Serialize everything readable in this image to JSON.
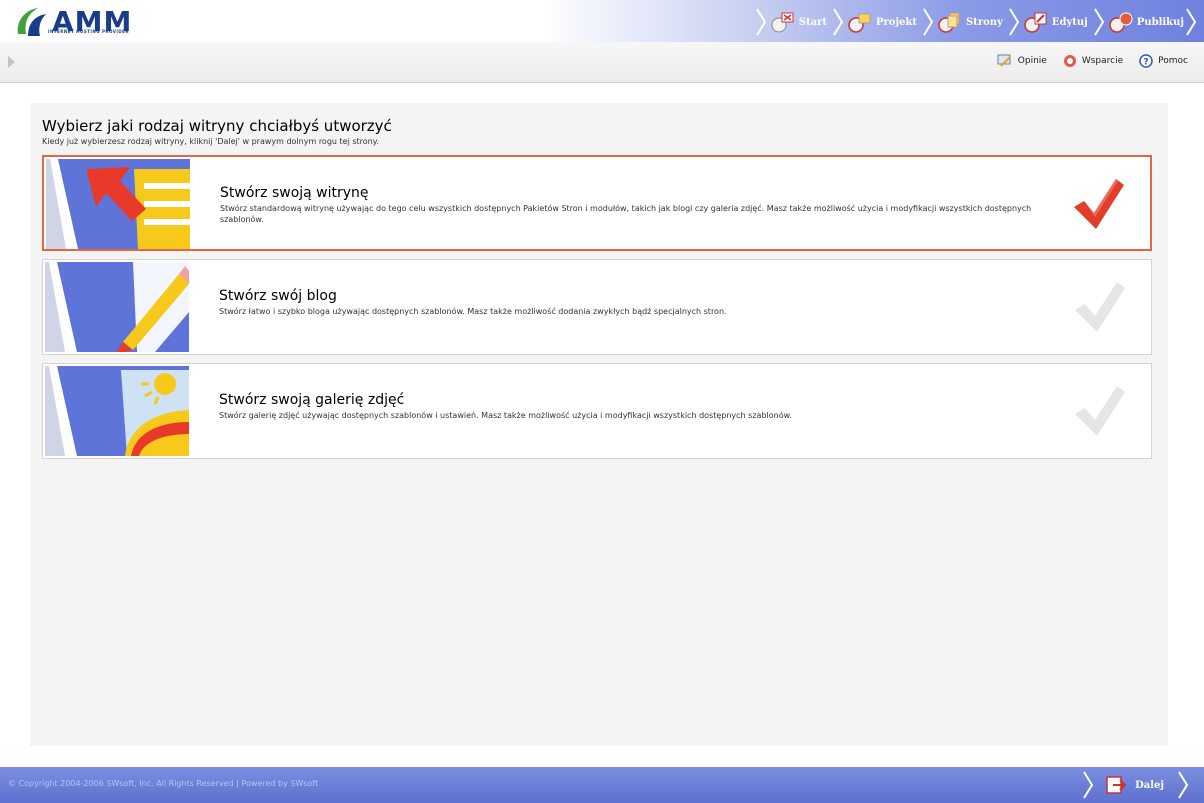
{
  "header": {
    "logo_text": "AMM",
    "logo_subtitle": "INTERNET HOSTING PROVIDER",
    "nav": [
      {
        "label": "Start"
      },
      {
        "label": "Projekt"
      },
      {
        "label": "Strony"
      },
      {
        "label": "Edytuj"
      },
      {
        "label": "Publikuj"
      }
    ]
  },
  "toolbar": {
    "links": [
      {
        "label": "Opinie",
        "icon": "feedback-icon"
      },
      {
        "label": "Wsparcie",
        "icon": "support-icon"
      },
      {
        "label": "Pomoc",
        "icon": "help-icon"
      }
    ]
  },
  "main": {
    "title": "Wybierz jaki rodzaj witryny chciałbyś utworzyć",
    "subtitle": "Kiedy już wybierzesz rodzaj witryny, kliknij 'Dalej' w prawym dolnym rogu tej strony.",
    "options": [
      {
        "title": "Stwórz swoją witrynę",
        "description": "Stwórz standardową witrynę używając do tego celu wszystkich dostępnych Pakietów Stron i modułów, takich jak blogi czy galeria zdjęć. Masz także możliwość użycia i modyfikacji wszystkich dostępnych szablonów.",
        "selected": true,
        "icon": "website-icon"
      },
      {
        "title": "Stwórz swój blog",
        "description": "Stwórz łatwo i szybko bloga używając dostępnych szablonów. Masz także możliwość dodania zwykłych bądź specjalnych stron.",
        "selected": false,
        "icon": "blog-pencil-icon"
      },
      {
        "title": "Stwórz swoją galerię zdjęć",
        "description": "Stwórz galerię zdjęć używając dostępnych szablonów i ustawień. Masz także możliwość użycia i modyfikacji wszystkich dostępnych szablonów.",
        "selected": false,
        "icon": "gallery-sun-icon"
      }
    ]
  },
  "footer": {
    "copyright": "© Copyright 2004-2006 SWsoft, Inc. All Rights Reserved  |  Powered by  SWsoft",
    "next_label": "Dalej"
  },
  "colors": {
    "selected_border": "#e46645",
    "check_active": "#e03d2c",
    "check_inactive": "#e6e6e6",
    "footer_blue": "#6477d6",
    "logo_blue": "#1a3d8a"
  }
}
